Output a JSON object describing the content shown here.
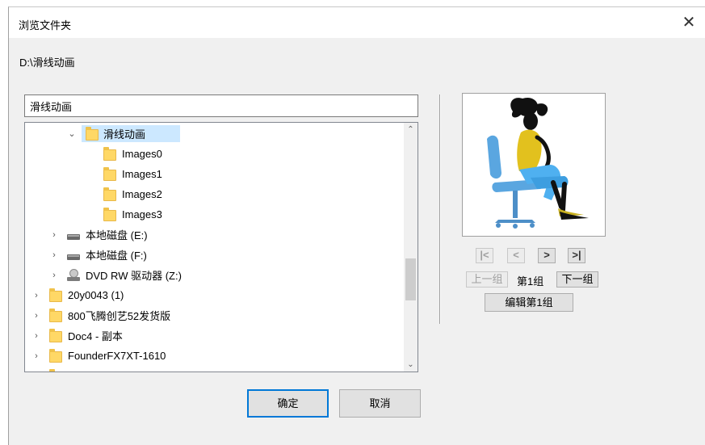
{
  "dialog": {
    "title": "浏览文件夹",
    "close_glyph": "✕",
    "current_path": "D:\\滑线动画"
  },
  "folder_name_input": {
    "value": "滑线动画"
  },
  "tree": {
    "items": [
      {
        "label": "滑线动画",
        "icon": "folder-icon",
        "expander": "chevron-down-icon",
        "selected": true
      },
      {
        "label": "Images0",
        "icon": "folder-icon"
      },
      {
        "label": "Images1",
        "icon": "folder-icon"
      },
      {
        "label": "Images2",
        "icon": "folder-icon"
      },
      {
        "label": "Images3",
        "icon": "folder-icon"
      },
      {
        "label": "本地磁盘 (E:)",
        "icon": "drive-icon",
        "expander": "chevron-right-icon"
      },
      {
        "label": "本地磁盘 (F:)",
        "icon": "drive-icon",
        "expander": "chevron-right-icon"
      },
      {
        "label": "DVD RW 驱动器 (Z:)",
        "icon": "dvd-drive-icon",
        "expander": "chevron-right-icon"
      },
      {
        "label": "20y0043 (1)",
        "icon": "folder-icon",
        "expander": "chevron-right-icon"
      },
      {
        "label": "800飞腾创艺52发货版",
        "icon": "folder-icon",
        "expander": "chevron-right-icon"
      },
      {
        "label": "Doc4 - 副本",
        "icon": "folder-icon",
        "expander": "chevron-right-icon"
      },
      {
        "label": "FounderFX7XT-1610",
        "icon": "folder-icon",
        "expander": "chevron-right-icon"
      }
    ],
    "scroll_up_glyph": "⌃",
    "scroll_down_glyph": "⌄"
  },
  "preview": {
    "nav": {
      "first": "|<",
      "prev": "<",
      "next": ">",
      "last": ">|"
    },
    "prev_group": "上一组",
    "group_label": "第1组",
    "next_group": "下一组",
    "edit_group": "编辑第1组"
  },
  "buttons": {
    "ok": "确定",
    "cancel": "取消"
  },
  "colors": {
    "selection": "#cce8ff",
    "accent": "#0078d7",
    "folder": "#ffd866"
  }
}
